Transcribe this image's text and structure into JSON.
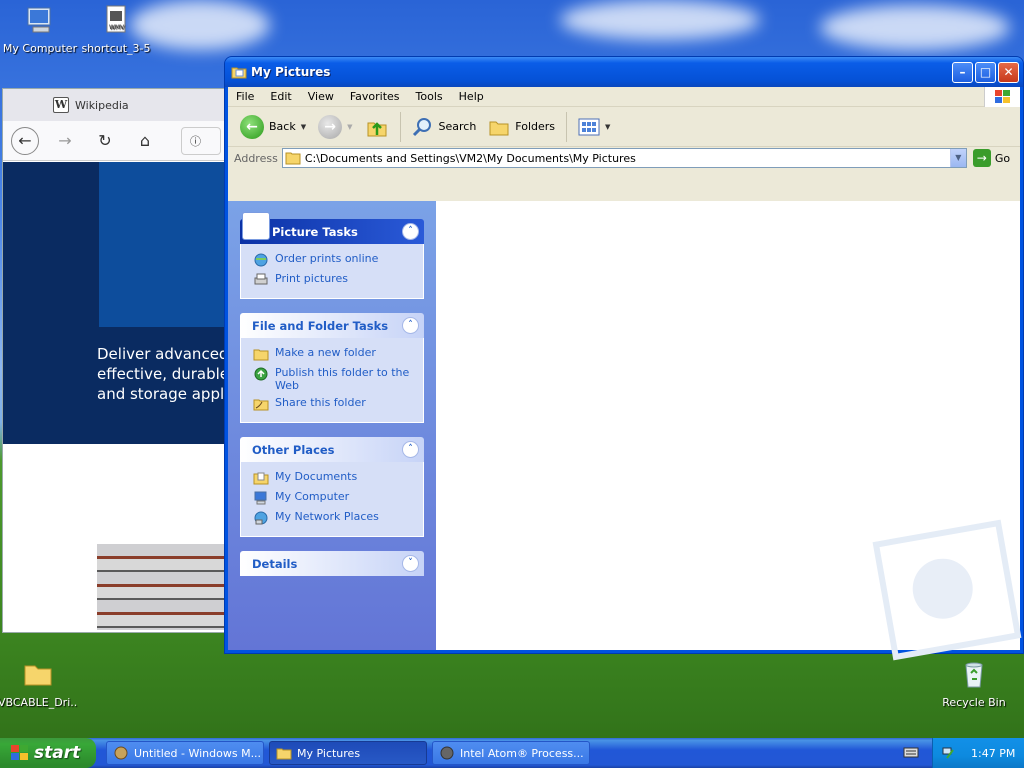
{
  "desktop": {
    "icons": [
      {
        "label": "My Computer"
      },
      {
        "label": "shortcut_3-5"
      },
      {
        "label": "VBCABLE_Dri..."
      },
      {
        "label": "Recycle Bin"
      }
    ]
  },
  "browser": {
    "tab_title": "Wikipedia",
    "hero_text": [
      "Deliver advanced",
      "effective, durable,",
      "and storage appli"
    ]
  },
  "window": {
    "title": "My Pictures",
    "menu": [
      "File",
      "Edit",
      "View",
      "Favorites",
      "Tools",
      "Help"
    ],
    "toolbar": {
      "back": "Back",
      "search": "Search",
      "folders": "Folders"
    },
    "address": {
      "label": "Address",
      "value": "C:\\Documents and Settings\\VM2\\My Documents\\My Pictures",
      "go": "Go"
    },
    "panels": {
      "picture_tasks": {
        "title": "Picture Tasks",
        "items": [
          "Order prints online",
          "Print pictures"
        ]
      },
      "file_folder_tasks": {
        "title": "File and Folder Tasks",
        "items": [
          "Make a new folder",
          "Publish this folder to the Web",
          "Share this folder"
        ]
      },
      "other_places": {
        "title": "Other Places",
        "items": [
          "My Documents",
          "My Computer",
          "My Network Places"
        ]
      },
      "details": {
        "title": "Details"
      }
    }
  },
  "taskbar": {
    "start": "start",
    "tasks": [
      "Untitled - Windows M...",
      "My Pictures",
      "Intel Atom® Process..."
    ],
    "clock": "1:47 PM"
  }
}
